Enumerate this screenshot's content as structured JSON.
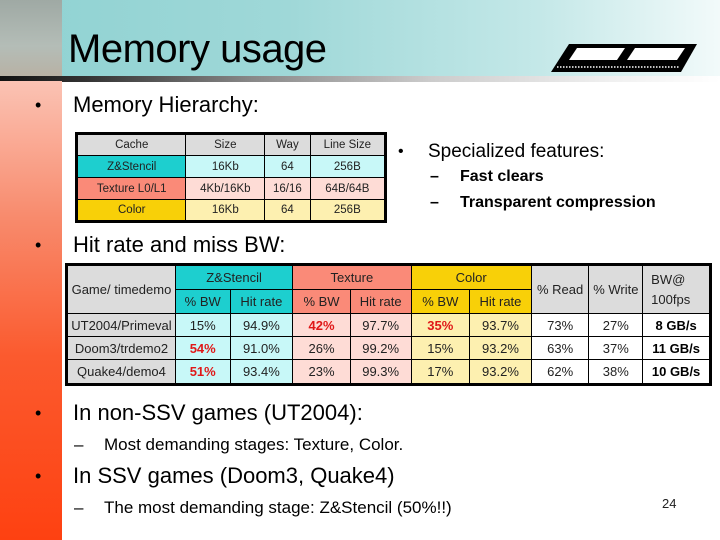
{
  "slide": {
    "title": "Memory usage",
    "page_number": "24",
    "title_icon": "memory-module-icon"
  },
  "bullets": {
    "memory_hierarchy": "Memory Hierarchy:",
    "specialized": "Specialized features:",
    "specialized_items": [
      "Fast clears",
      "Transparent compression"
    ],
    "hit_rate": "Hit rate and miss BW:",
    "non_ssv": "In non-SSV games (UT2004):",
    "non_ssv_sub": "Most demanding stages: Texture, Color.",
    "ssv": "In SSV games (Doom3, Quake4)",
    "ssv_sub": "The most demanding stage: Z&Stencil (50%!!)"
  },
  "bullet_glyph": "•",
  "dash_glyph": "–",
  "memory_table": {
    "headers": [
      "Cache",
      "Size",
      "Way",
      "Line Size"
    ],
    "rows": [
      [
        "Z&Stencil",
        "16Kb",
        "64",
        "256B"
      ],
      [
        "Texture L0/L1",
        "4Kb/16Kb",
        "16/16",
        "64B/64B"
      ],
      [
        "Color",
        "16Kb",
        "64",
        "256B"
      ]
    ]
  },
  "hit_table": {
    "game_header": "Game/ timedemo",
    "group_headers": [
      "Z&Stencil",
      "Texture",
      "Color"
    ],
    "sub_headers": [
      "% BW",
      "Hit rate"
    ],
    "read_header": "% Read",
    "write_header": "% Write",
    "bw_header": "BW@ 100fps",
    "rows": [
      {
        "game": "UT2004/Primeval",
        "zs_bw": "15%",
        "zs_hit": "94.9%",
        "tex_bw": "42%",
        "tex_hit": "97.7%",
        "col_bw": "35%",
        "col_hit": "93.7%",
        "read": "73%",
        "write": "27%",
        "bw": "8 GB/s"
      },
      {
        "game": "Doom3/trdemo2",
        "zs_bw": "54%",
        "zs_hit": "91.0%",
        "tex_bw": "26%",
        "tex_hit": "99.2%",
        "col_bw": "15%",
        "col_hit": "93.2%",
        "read": "63%",
        "write": "37%",
        "bw": "11 GB/s"
      },
      {
        "game": "Quake4/demo4",
        "zs_bw": "51%",
        "zs_hit": "93.4%",
        "tex_bw": "23%",
        "tex_hit": "99.3%",
        "col_bw": "17%",
        "col_hit": "93.2%",
        "read": "62%",
        "write": "38%",
        "bw": "10 GB/s"
      }
    ],
    "highlighted": [
      "UT2004/Primeval.tex_bw",
      "UT2004/Primeval.col_bw",
      "Doom3/trdemo2.zs_bw",
      "Quake4/demo4.zs_bw"
    ]
  },
  "colors": {
    "zstencil": "#1dcfcf",
    "texture": "#fa8a78",
    "color": "#f8d008",
    "highlight_red": "#e01818",
    "title_band": "#9fd8d8",
    "left_bar": "#fe4111"
  }
}
